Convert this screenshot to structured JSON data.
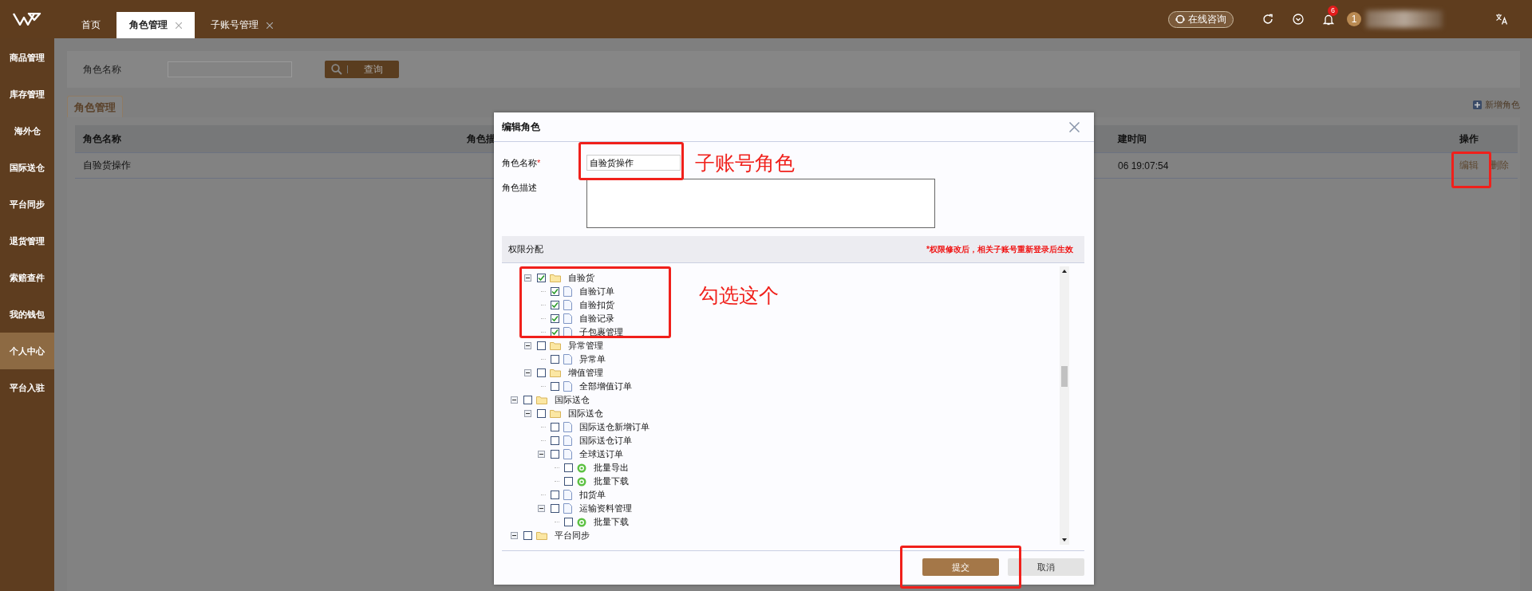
{
  "top_tabs": [
    {
      "label": "首页",
      "selected": false,
      "closable": false
    },
    {
      "label": "角色管理",
      "selected": true,
      "closable": true
    },
    {
      "label": "子账号管理",
      "selected": false,
      "closable": true
    }
  ],
  "header": {
    "consult_button": "在线咨询",
    "notification_count": "6",
    "avatar_label": "1"
  },
  "sidebar": [
    {
      "label": "商品管理",
      "selected": false
    },
    {
      "label": "库存管理",
      "selected": false
    },
    {
      "label": "海外仓",
      "selected": false
    },
    {
      "label": "国际送仓",
      "selected": false
    },
    {
      "label": "平台同步",
      "selected": false
    },
    {
      "label": "退货管理",
      "selected": false
    },
    {
      "label": "索赔查件",
      "selected": false
    },
    {
      "label": "我的钱包",
      "selected": false
    },
    {
      "label": "个人中心",
      "selected": true
    },
    {
      "label": "平台入驻",
      "selected": false
    }
  ],
  "search": {
    "label": "角色名称",
    "button": "查询"
  },
  "section_tab": "角色管理",
  "add_button": "新增角色",
  "table": {
    "columns": [
      "角色名称",
      "角色描",
      "建时间",
      "操作"
    ],
    "rows": [
      {
        "name": "自验货操作",
        "time": "06 19:07:54",
        "actions": [
          "编辑",
          "删除"
        ]
      }
    ]
  },
  "dialog": {
    "title": "编辑角色",
    "fields": [
      {
        "label": "角色名称",
        "required_mark": "*",
        "kind": "input",
        "value": "自验货操作"
      },
      {
        "label": "角色描述",
        "kind": "textarea"
      }
    ],
    "permissions": {
      "title": "权限分配",
      "notice": "*权限修改后，相关子账号重新登录后生效",
      "partial_branch": [
        {
          "label": "自验货",
          "kind": "folder",
          "checked": true,
          "expanded": true,
          "children": [
            {
              "label": "自验订单",
              "kind": "page",
              "checked": true
            },
            {
              "label": "自验扣货",
              "kind": "page",
              "checked": true
            },
            {
              "label": "自验记录",
              "kind": "page",
              "checked": true
            },
            {
              "label": "子包裹管理",
              "kind": "page",
              "checked": true
            }
          ]
        },
        {
          "label": "异常管理",
          "kind": "folder",
          "checked": false,
          "expanded": true,
          "children": [
            {
              "label": "异常单",
              "kind": "page",
              "checked": false
            }
          ]
        },
        {
          "label": "增值管理",
          "kind": "folder",
          "checked": false,
          "expanded": true,
          "children": [
            {
              "label": "全部增值订单",
              "kind": "page",
              "checked": false
            }
          ]
        }
      ],
      "items": [
        {
          "label": "国际送仓",
          "kind": "folder",
          "checked": false,
          "expanded": true,
          "children": [
            {
              "label": "国际送仓",
              "kind": "folder",
              "checked": false,
              "expanded": true,
              "children": [
                {
                  "label": "国际送仓新增订单",
                  "kind": "page",
                  "checked": false
                },
                {
                  "label": "国际送仓订单",
                  "kind": "page",
                  "checked": false
                },
                {
                  "label": "全球送订单",
                  "kind": "page",
                  "checked": false,
                  "expanded": true,
                  "children": [
                    {
                      "label": "批量导出",
                      "kind": "action",
                      "checked": false
                    },
                    {
                      "label": "批量下载",
                      "kind": "action",
                      "checked": false
                    }
                  ]
                },
                {
                  "label": "扣货单",
                  "kind": "page",
                  "checked": false
                },
                {
                  "label": "运输资料管理",
                  "kind": "page",
                  "checked": false,
                  "expanded": true,
                  "children": [
                    {
                      "label": "批量下载",
                      "kind": "action",
                      "checked": false
                    }
                  ]
                }
              ]
            }
          ]
        },
        {
          "label": "平台同步",
          "kind": "folder",
          "checked": false,
          "expanded": true
        }
      ]
    },
    "buttons": [
      {
        "label": "提交",
        "kind": "primary"
      },
      {
        "label": "取消",
        "kind": "secondary"
      }
    ]
  },
  "annotations": [
    "子账号角色",
    "勾选这个"
  ]
}
